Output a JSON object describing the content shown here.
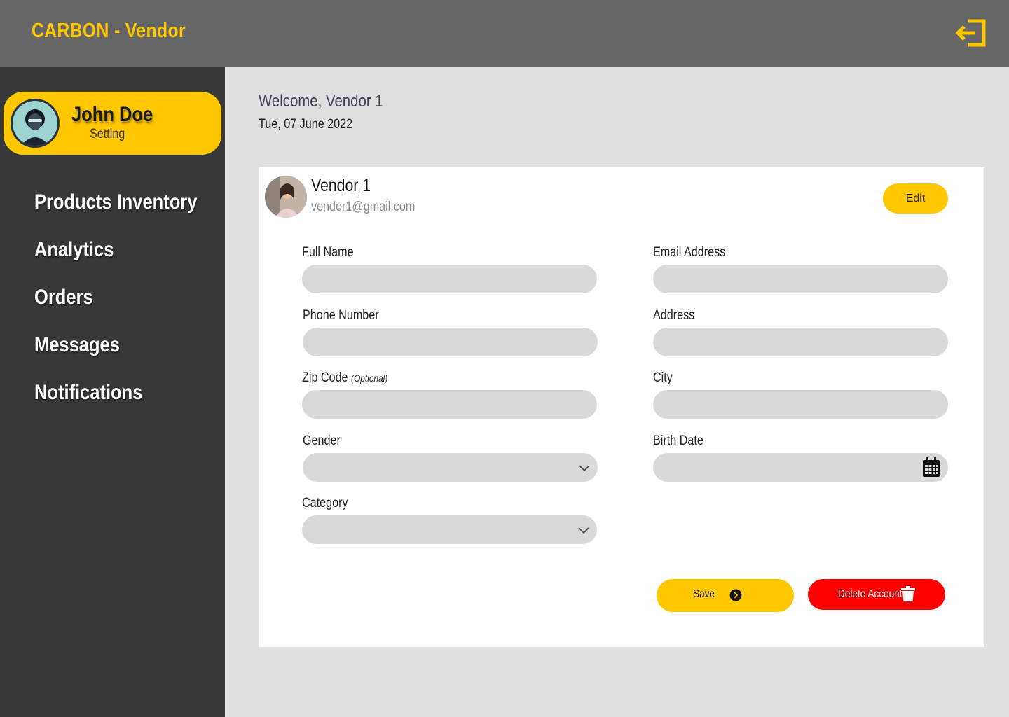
{
  "app": {
    "title": "CARBON - Vendor",
    "accent_color": "#ffc700",
    "danger_color": "#ff0000",
    "logout_icon": "logout-icon"
  },
  "sidebar": {
    "profile": {
      "name": "John Doe",
      "subtitle": "Setting",
      "avatar_icon": "user-avatar-icon"
    },
    "items": [
      {
        "label": "Products Inventory"
      },
      {
        "label": "Analytics"
      },
      {
        "label": "Orders"
      },
      {
        "label": "Messages"
      },
      {
        "label": "Notifications"
      }
    ]
  },
  "header": {
    "welcome": "Welcome, Vendor 1",
    "date": "Tue, 07 June 2022"
  },
  "vendor_card": {
    "name": "Vendor 1",
    "email": "vendor1@gmail.com",
    "edit_label": "Edit"
  },
  "form": {
    "full_name": {
      "label": "Full Name",
      "value": ""
    },
    "email": {
      "label": "Email Address",
      "value": ""
    },
    "phone": {
      "label": "Phone Number",
      "value": ""
    },
    "address": {
      "label": "Address",
      "value": ""
    },
    "zip": {
      "label": "Zip Code",
      "optional": "(Optional)",
      "value": ""
    },
    "city": {
      "label": "City",
      "value": ""
    },
    "gender": {
      "label": "Gender",
      "value": ""
    },
    "birth_date": {
      "label": "Birth Date",
      "value": "",
      "icon": "calendar-icon"
    },
    "category": {
      "label": "Category",
      "value": ""
    }
  },
  "actions": {
    "save_label": "Save",
    "save_icon": "chevron-right-circle-icon",
    "delete_label": "Delete Account",
    "delete_icon": "trash-icon"
  }
}
